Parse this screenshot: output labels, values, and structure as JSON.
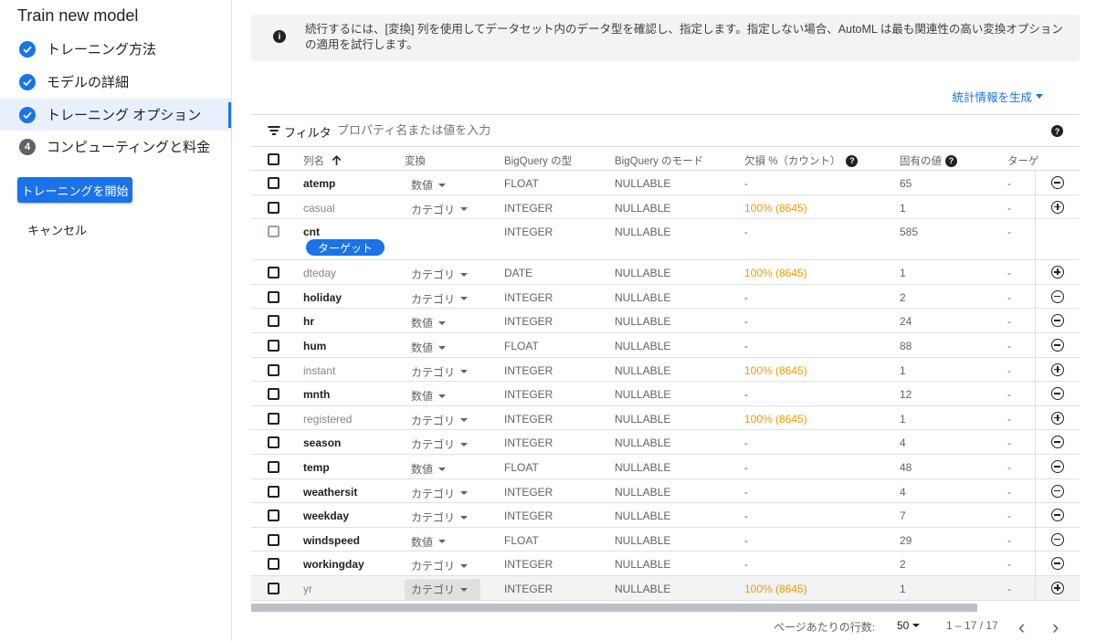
{
  "sidebar": {
    "title": "Train new model",
    "steps": [
      {
        "label": "トレーニング方法",
        "state": "done"
      },
      {
        "label": "モデルの詳細",
        "state": "done"
      },
      {
        "label": "トレーニング オプション",
        "state": "done-active"
      },
      {
        "label": "コンピューティングと料金",
        "state": "pending",
        "number": "4"
      }
    ],
    "start_button": "トレーニングを開始",
    "cancel_button": "キャンセル"
  },
  "info": {
    "icon": "info-icon",
    "text": "続行するには、[変換] 列を使用してデータセット内のデータ型を確認し、指定します。指定しない場合、AutoML は最も関連性の高い変換オプションの適用を試行します。"
  },
  "generate_stats": "統計情報を生成",
  "filter": {
    "label": "フィルタ",
    "placeholder": "プロパティ名または値を入力"
  },
  "table": {
    "headers": {
      "name": "列名",
      "transform": "変換",
      "bq_type": "BigQuery の型",
      "bq_mode": "BigQuery のモード",
      "missing": "欠損 %（カウント）",
      "distinct": "固有の値",
      "target": "ターゲ"
    },
    "target_chip": "ターゲット",
    "rows": [
      {
        "name": "atemp",
        "transform": "数値",
        "bq_type": "FLOAT",
        "bq_mode": "NULLABLE",
        "missing": "-",
        "distinct": "65",
        "target": "-",
        "action": "minus",
        "dim": false
      },
      {
        "name": "casual",
        "transform": "カテゴリ",
        "bq_type": "INTEGER",
        "bq_mode": "NULLABLE",
        "missing": "100% (8645)",
        "distinct": "1",
        "target": "-",
        "action": "plus",
        "dim": true
      },
      {
        "name": "cnt",
        "transform": "",
        "bq_type": "INTEGER",
        "bq_mode": "NULLABLE",
        "missing": "-",
        "distinct": "585",
        "target": "-",
        "action": "none",
        "dim": false,
        "is_target": true
      },
      {
        "name": "dteday",
        "transform": "カテゴリ",
        "bq_type": "DATE",
        "bq_mode": "NULLABLE",
        "missing": "100% (8645)",
        "distinct": "1",
        "target": "-",
        "action": "plus",
        "dim": true
      },
      {
        "name": "holiday",
        "transform": "カテゴリ",
        "bq_type": "INTEGER",
        "bq_mode": "NULLABLE",
        "missing": "-",
        "distinct": "2",
        "target": "-",
        "action": "minus",
        "dim": false
      },
      {
        "name": "hr",
        "transform": "数値",
        "bq_type": "INTEGER",
        "bq_mode": "NULLABLE",
        "missing": "-",
        "distinct": "24",
        "target": "-",
        "action": "minus",
        "dim": false
      },
      {
        "name": "hum",
        "transform": "数値",
        "bq_type": "FLOAT",
        "bq_mode": "NULLABLE",
        "missing": "-",
        "distinct": "88",
        "target": "-",
        "action": "minus",
        "dim": false
      },
      {
        "name": "instant",
        "transform": "カテゴリ",
        "bq_type": "INTEGER",
        "bq_mode": "NULLABLE",
        "missing": "100% (8645)",
        "distinct": "1",
        "target": "-",
        "action": "plus",
        "dim": true
      },
      {
        "name": "mnth",
        "transform": "数値",
        "bq_type": "INTEGER",
        "bq_mode": "NULLABLE",
        "missing": "-",
        "distinct": "12",
        "target": "-",
        "action": "minus",
        "dim": false
      },
      {
        "name": "registered",
        "transform": "カテゴリ",
        "bq_type": "INTEGER",
        "bq_mode": "NULLABLE",
        "missing": "100% (8645)",
        "distinct": "1",
        "target": "-",
        "action": "plus",
        "dim": true
      },
      {
        "name": "season",
        "transform": "カテゴリ",
        "bq_type": "INTEGER",
        "bq_mode": "NULLABLE",
        "missing": "-",
        "distinct": "4",
        "target": "-",
        "action": "minus",
        "dim": false
      },
      {
        "name": "temp",
        "transform": "数値",
        "bq_type": "FLOAT",
        "bq_mode": "NULLABLE",
        "missing": "-",
        "distinct": "48",
        "target": "-",
        "action": "minus",
        "dim": false
      },
      {
        "name": "weathersit",
        "transform": "カテゴリ",
        "bq_type": "INTEGER",
        "bq_mode": "NULLABLE",
        "missing": "-",
        "distinct": "4",
        "target": "-",
        "action": "minus",
        "dim": false
      },
      {
        "name": "weekday",
        "transform": "カテゴリ",
        "bq_type": "INTEGER",
        "bq_mode": "NULLABLE",
        "missing": "-",
        "distinct": "7",
        "target": "-",
        "action": "minus",
        "dim": false
      },
      {
        "name": "windspeed",
        "transform": "数値",
        "bq_type": "FLOAT",
        "bq_mode": "NULLABLE",
        "missing": "-",
        "distinct": "29",
        "target": "-",
        "action": "minus",
        "dim": false
      },
      {
        "name": "workingday",
        "transform": "カテゴリ",
        "bq_type": "INTEGER",
        "bq_mode": "NULLABLE",
        "missing": "-",
        "distinct": "2",
        "target": "-",
        "action": "minus",
        "dim": false
      },
      {
        "name": "yr",
        "transform": "カテゴリ",
        "bq_type": "INTEGER",
        "bq_mode": "NULLABLE",
        "missing": "100% (8645)",
        "distinct": "1",
        "target": "-",
        "action": "plus",
        "dim": true,
        "highlighted": true
      }
    ]
  },
  "pagination": {
    "rows_per_page_label": "ページあたりの行数:",
    "rows_per_page": "50",
    "range": "1 – 17 / 17",
    "prev": "‹",
    "next": "›"
  },
  "colors": {
    "accent": "#1a73e8",
    "warning": "#f29900"
  }
}
